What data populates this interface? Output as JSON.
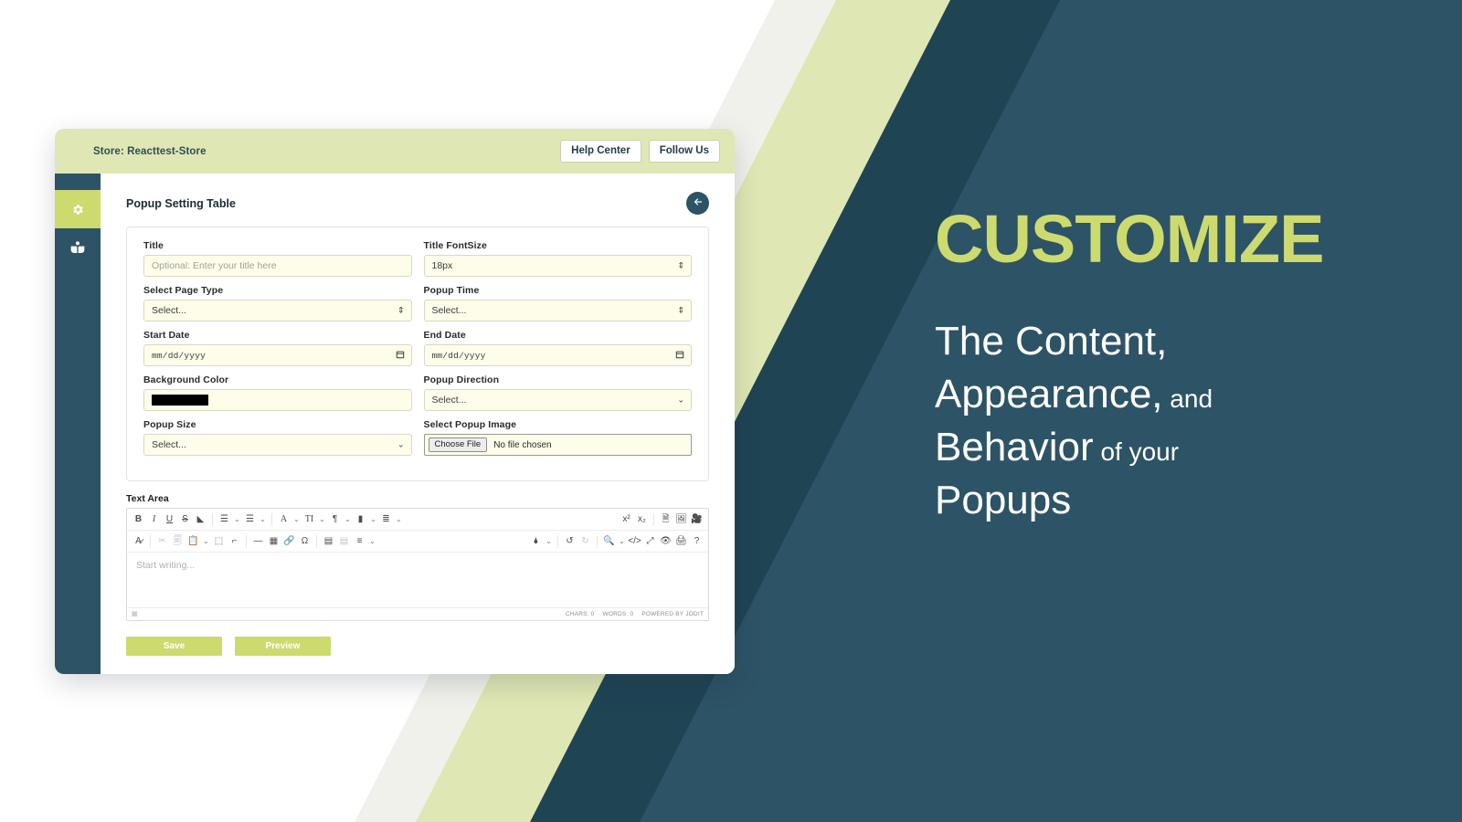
{
  "theme": {
    "dark_teal": "#2d5366",
    "deep_teal": "#1f4454",
    "lime": "#cdda6e",
    "pale_lime": "#dfe7b4",
    "off_white": "#f1f1ec",
    "field_bg": "#fdfde9"
  },
  "window": {
    "store_label": "Store: Reacttest-Store",
    "help_center_label": "Help Center",
    "follow_us_label": "Follow Us"
  },
  "sidebar": {
    "items": [
      {
        "icon": "gear-icon",
        "active": true
      },
      {
        "icon": "book-reader-icon",
        "active": false
      }
    ]
  },
  "page": {
    "title": "Popup Setting Table",
    "back_icon": "arrow-left-icon"
  },
  "form": {
    "fields": [
      {
        "label": "Title",
        "type": "text",
        "value": "",
        "placeholder": "Optional: Enter your title here"
      },
      {
        "label": "Title FontSize",
        "type": "stepper-select",
        "value": "18px"
      },
      {
        "label": "Select Page Type",
        "type": "stepper-select",
        "value": "Select..."
      },
      {
        "label": "Popup Time",
        "type": "stepper-select",
        "value": "Select..."
      },
      {
        "label": "Start Date",
        "type": "date",
        "value": "mm/dd/yyyy"
      },
      {
        "label": "End Date",
        "type": "date",
        "value": "mm/dd/yyyy"
      },
      {
        "label": "Background Color",
        "type": "color",
        "value": "#000000"
      },
      {
        "label": "Popup Direction",
        "type": "select",
        "value": "Select..."
      },
      {
        "label": "Popup Size",
        "type": "select",
        "value": "Select..."
      },
      {
        "label": "Select Popup Image",
        "type": "file",
        "button_label": "Choose File",
        "value": "No file chosen"
      }
    ]
  },
  "editor": {
    "label": "Text Area",
    "placeholder": "Start writing...",
    "toolbar_row1": [
      {
        "name": "bold-icon",
        "glyph": "B",
        "style": "bold"
      },
      {
        "name": "italic-icon",
        "glyph": "I",
        "style": "italic"
      },
      {
        "name": "underline-icon",
        "glyph": "U",
        "style": "underline"
      },
      {
        "name": "strikethrough-icon",
        "glyph": "S",
        "style": "strike"
      },
      {
        "name": "eraser-icon",
        "glyph": "◣",
        "style": "plain"
      },
      {
        "sep": true
      },
      {
        "name": "unordered-list-icon",
        "glyph": "☰",
        "style": "plain",
        "caret": true
      },
      {
        "name": "ordered-list-icon",
        "glyph": "☰",
        "style": "plain",
        "caret": true
      },
      {
        "sep": true
      },
      {
        "name": "font-family-icon",
        "glyph": "A",
        "style": "serif",
        "caret": true
      },
      {
        "name": "font-size-icon",
        "glyph": "TI",
        "style": "serif",
        "caret": true
      },
      {
        "name": "paragraph-icon",
        "glyph": "¶",
        "style": "plain",
        "caret": true
      },
      {
        "name": "class-span-icon",
        "glyph": "▮",
        "style": "plain",
        "caret": true
      },
      {
        "name": "line-height-icon",
        "glyph": "≣",
        "style": "plain",
        "caret": true
      }
    ],
    "toolbar_row1_right": [
      {
        "name": "superscript-icon",
        "glyph": "x²"
      },
      {
        "name": "subscript-icon",
        "glyph": "x₂"
      },
      {
        "sep": true
      },
      {
        "name": "insert-file-icon",
        "glyph": "🗎"
      },
      {
        "name": "insert-image-icon",
        "glyph": "🖼"
      },
      {
        "name": "insert-video-icon",
        "glyph": "🎥"
      }
    ],
    "toolbar_row2": [
      {
        "name": "format-brush-icon",
        "glyph": "A̷",
        "dim": false
      },
      {
        "sep": true
      },
      {
        "name": "cut-icon",
        "glyph": "✂",
        "dim": true
      },
      {
        "name": "copy-icon",
        "glyph": "🗐",
        "dim": true
      },
      {
        "name": "paste-icon",
        "glyph": "📋",
        "dim": false,
        "caret": true
      },
      {
        "name": "select-all-icon",
        "glyph": "⬚",
        "dim": false
      },
      {
        "name": "paint-format-icon",
        "glyph": "⌐",
        "dim": false
      },
      {
        "sep": true
      },
      {
        "name": "horizontal-rule-icon",
        "glyph": "—"
      },
      {
        "name": "table-icon",
        "glyph": "▦"
      },
      {
        "name": "link-icon",
        "glyph": "🔗"
      },
      {
        "name": "symbol-icon",
        "glyph": "Ω"
      },
      {
        "sep": true
      },
      {
        "name": "indent-increase-icon",
        "glyph": "▤",
        "dim": false
      },
      {
        "name": "indent-decrease-icon",
        "glyph": "▤",
        "dim": true
      },
      {
        "name": "align-icon",
        "glyph": "≡",
        "caret": true
      }
    ],
    "toolbar_row2_right": [
      {
        "name": "text-color-icon",
        "glyph": "🌢",
        "caret": true
      },
      {
        "sep": true
      },
      {
        "name": "undo-icon",
        "glyph": "↺"
      },
      {
        "name": "redo-icon",
        "glyph": "↻",
        "dim": true
      },
      {
        "sep": true
      },
      {
        "name": "find-icon",
        "glyph": "🔍",
        "caret": true
      },
      {
        "name": "source-code-icon",
        "glyph": "</>"
      },
      {
        "name": "fullsize-icon",
        "glyph": "⤢"
      },
      {
        "name": "preview-eye-icon",
        "glyph": "👁"
      },
      {
        "name": "print-icon",
        "glyph": "🖨"
      },
      {
        "name": "about-help-icon",
        "glyph": "?"
      }
    ],
    "status": {
      "chars": "CHARS: 0",
      "words": "WORDS: 0",
      "powered": "POWERED BY JODIT"
    }
  },
  "actions": {
    "save_label": "Save",
    "preview_label": "Preview"
  },
  "promo": {
    "headline": "CUSTOMIZE",
    "line1_a": "The Content,",
    "line2_a": "Appearance,",
    "line2_b": " and",
    "line3_a": "Behavior",
    "line3_b": " of your",
    "line4_a": "Popups"
  }
}
